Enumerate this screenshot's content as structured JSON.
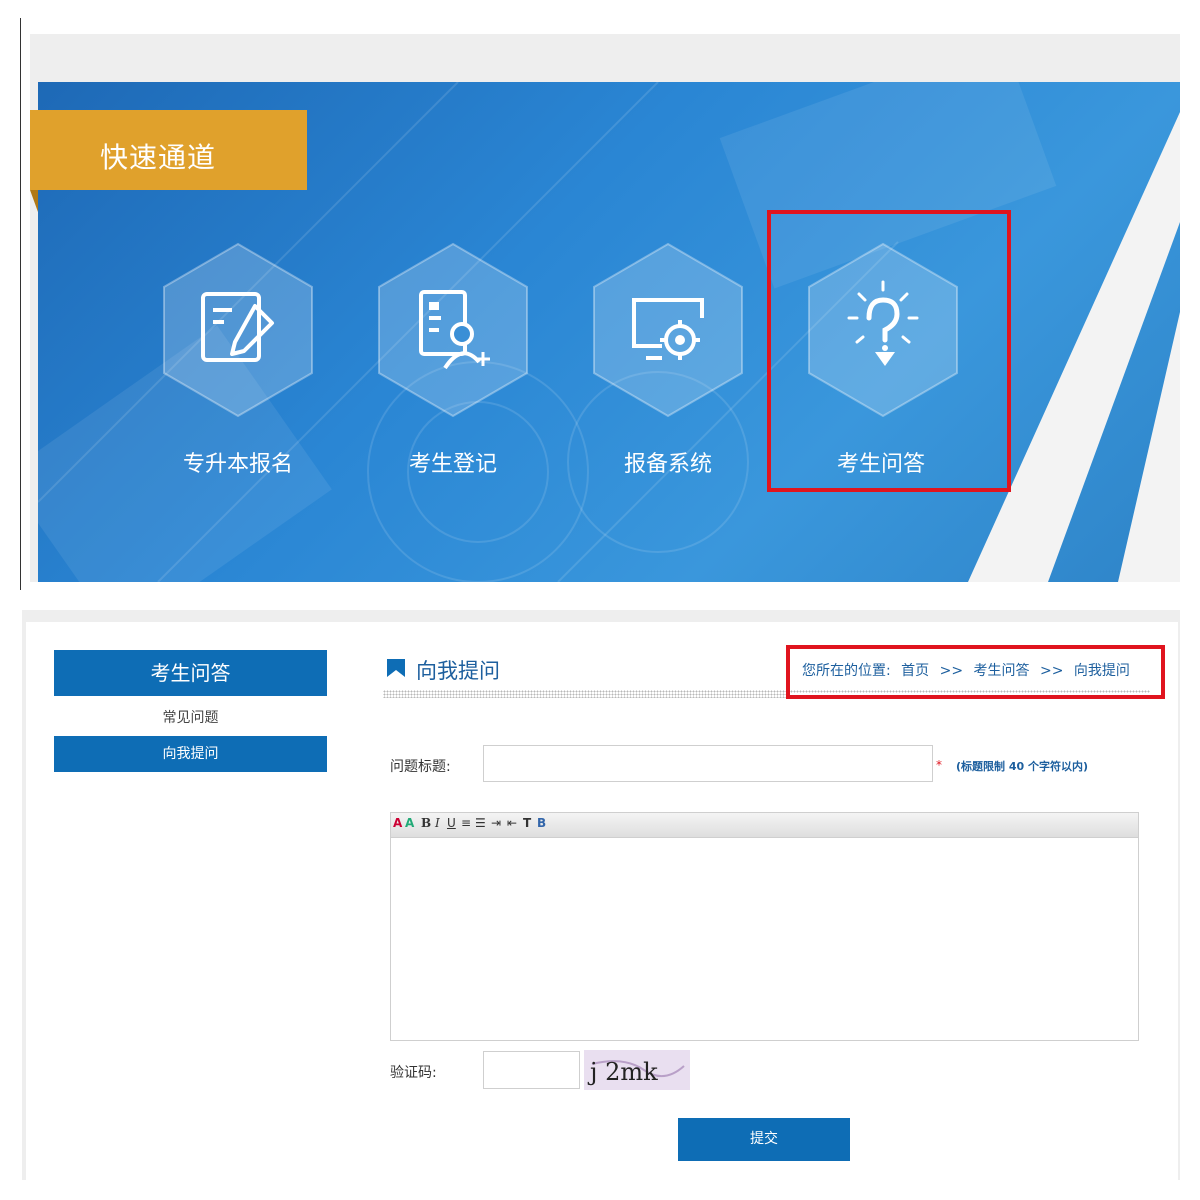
{
  "banner": {
    "tag_title": "快速通道",
    "tiles": [
      {
        "label": "专升本报名",
        "icon": "document-pen-icon"
      },
      {
        "label": "考生登记",
        "icon": "user-list-icon"
      },
      {
        "label": "报备系统",
        "icon": "monitor-gear-icon"
      },
      {
        "label": "考生问答",
        "icon": "lightbulb-question-icon"
      }
    ],
    "highlighted_tile": "考生问答"
  },
  "sidebar": {
    "heading": "考生问答",
    "items": [
      {
        "label": "常见问题",
        "active": false
      },
      {
        "label": "向我提问",
        "active": true
      }
    ]
  },
  "main": {
    "title": "向我提问",
    "breadcrumb": {
      "prefix": "您所在的位置:",
      "items": [
        "首页",
        ">>",
        "考生问答",
        ">>",
        "向我提问"
      ]
    },
    "form": {
      "title_label": "问题标题:",
      "title_value": "",
      "required_mark": "*",
      "title_hint": "(标题限制 40 个字符以内)",
      "toolbar_buttons": [
        "font-color-icon",
        "highlight-icon",
        "bold-icon",
        "italic-icon",
        "underline-icon",
        "align-icon",
        "list-icon",
        "indent-icon",
        "outdent-icon",
        "text-format-icon",
        "background-icon"
      ],
      "body_value": "",
      "captcha_label": "验证码:",
      "captcha_value": "",
      "captcha_text": "j 2mk",
      "submit_label": "提交"
    }
  },
  "colors": {
    "accent_blue": "#0e6db5",
    "tag_orange": "#e0a12c",
    "highlight_red": "#e0141e",
    "banner_blue": "#2a86d4"
  }
}
